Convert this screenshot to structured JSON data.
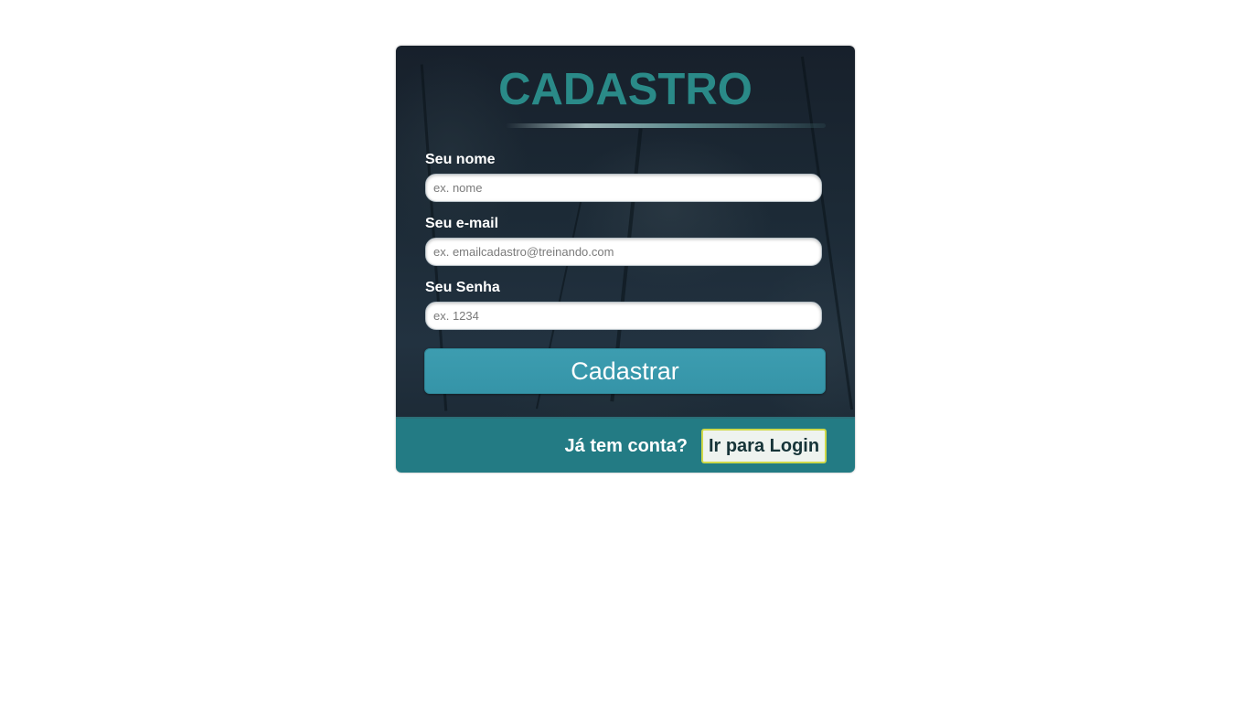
{
  "form": {
    "title": "CADASTRO",
    "name_label": "Seu nome",
    "name_placeholder": "ex. nome",
    "email_label": "Seu e-mail",
    "email_placeholder": "ex. emailcadastro@treinando.com",
    "password_label": "Seu Senha",
    "password_placeholder": "ex. 1234",
    "submit_label": "Cadastrar"
  },
  "footer": {
    "question": "Já tem conta?",
    "login_label": "Ir para Login"
  },
  "colors": {
    "title": "#2a8a88",
    "submit_button": "#3594a8",
    "footer_bar": "#237b84",
    "login_button_border": "#cfd94a"
  }
}
